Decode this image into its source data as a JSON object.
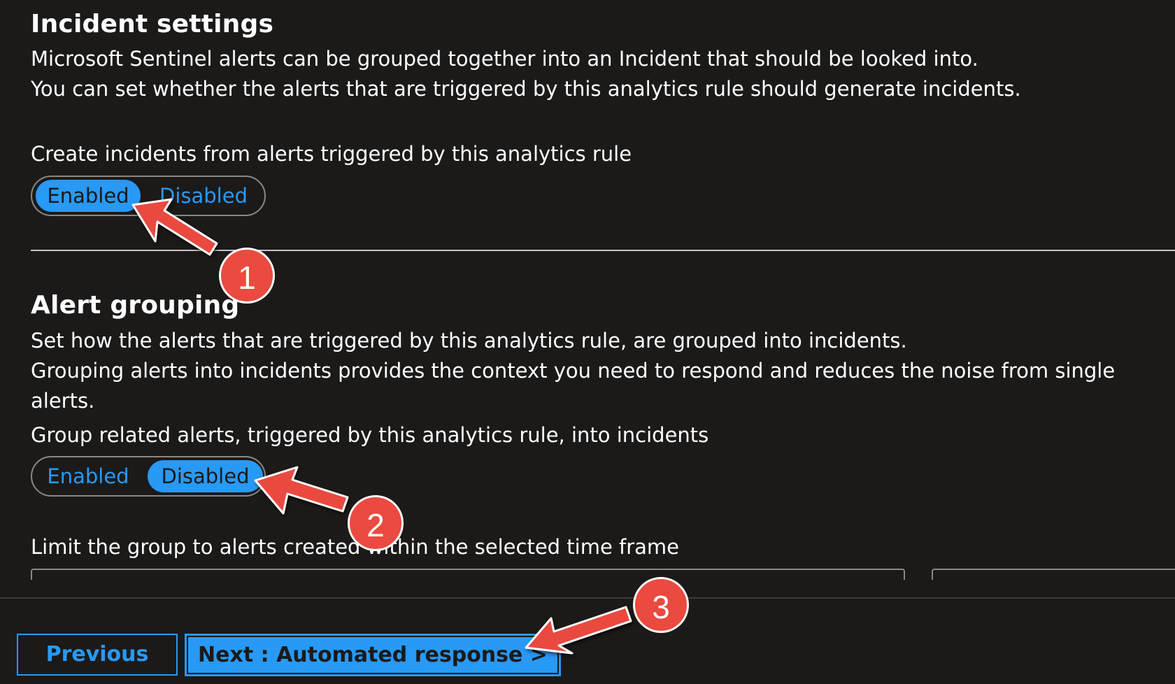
{
  "incident_settings": {
    "title": "Incident settings",
    "description_line1": "Microsoft Sentinel alerts can be grouped together into an Incident that should be looked into.",
    "description_line2": "You can set whether the alerts that are triggered by this analytics rule should generate incidents.",
    "create_incidents_label": "Create incidents from alerts triggered by this analytics rule",
    "toggle": {
      "enabled_label": "Enabled",
      "disabled_label": "Disabled",
      "selected": "Enabled"
    }
  },
  "alert_grouping": {
    "title": "Alert grouping",
    "description_line1": "Set how the alerts that are triggered by this analytics rule, are grouped into incidents.",
    "description_line2": "Grouping alerts into incidents provides the context you need to respond and reduces the noise from single alerts.",
    "group_label": "Group related alerts, triggered by this analytics rule, into incidents",
    "toggle": {
      "enabled_label": "Enabled",
      "disabled_label": "Disabled",
      "selected": "Disabled"
    },
    "limit_label": "Limit the group to alerts created within the selected time frame"
  },
  "footer": {
    "previous_label": "Previous",
    "next_label": "Next : Automated response >"
  },
  "annotations": {
    "badge1": "1",
    "badge2": "2",
    "badge3": "3"
  },
  "colors": {
    "accent": "#2899f5",
    "badge": "#ea4a3f",
    "background": "#1b1a19"
  }
}
